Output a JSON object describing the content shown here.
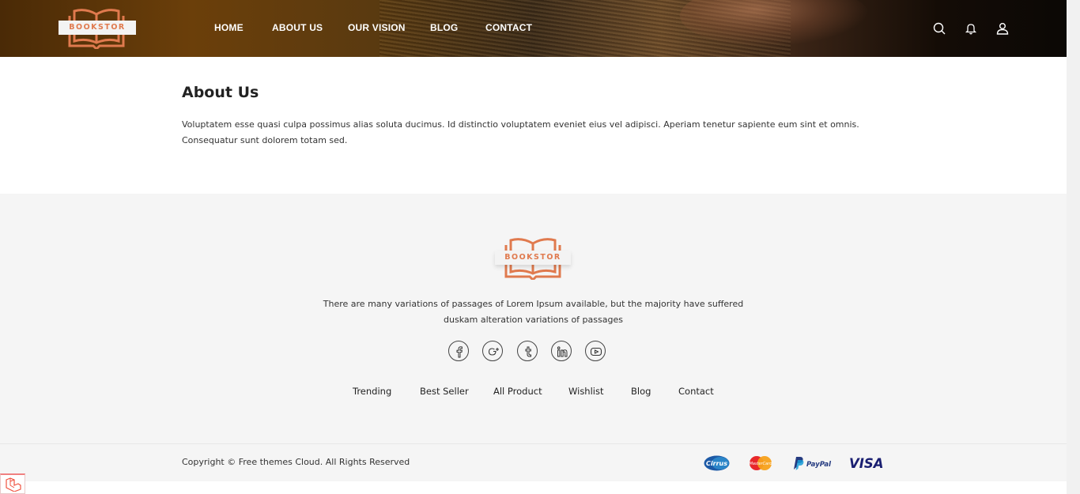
{
  "brand": {
    "name": "BOOKSTOR",
    "color": "#e07a4e"
  },
  "nav": {
    "items": [
      {
        "label": "HOME"
      },
      {
        "label": "ABOUT US"
      },
      {
        "label": "OUR VISION"
      },
      {
        "label": "BLOG"
      },
      {
        "label": "CONTACT"
      }
    ]
  },
  "header_icons": [
    "search-icon",
    "bell-icon",
    "user-icon"
  ],
  "about": {
    "title": "About Us",
    "text": "Voluptatem esse quasi culpa possimus alias soluta ducimus. Id distinctio voluptatem eveniet eius vel adipisci. Aperiam tenetur sapiente eum sint et omnis. Consequatur sunt dolorem totam sed."
  },
  "footer": {
    "description": "There are many variations of passages of Lorem Ipsum available, but the majority have suffered duskam alteration variations of passages",
    "social": [
      "facebook-icon",
      "google-plus-icon",
      "tumblr-icon",
      "linkedin-icon",
      "youtube-icon"
    ],
    "links": [
      {
        "label": "Trending"
      },
      {
        "label": "Best Seller"
      },
      {
        "label": "All Product"
      },
      {
        "label": "Wishlist"
      },
      {
        "label": "Blog"
      },
      {
        "label": "Contact"
      }
    ],
    "copyright": "Copyright © Free themes Cloud. All Rights Reserved",
    "payments": [
      {
        "name": "cirrus-icon",
        "label": "Cirrus"
      },
      {
        "name": "mastercard-icon",
        "label": "MasterCard"
      },
      {
        "name": "paypal-icon",
        "label": "PayPal"
      },
      {
        "name": "visa-icon",
        "label": "VISA"
      }
    ]
  }
}
